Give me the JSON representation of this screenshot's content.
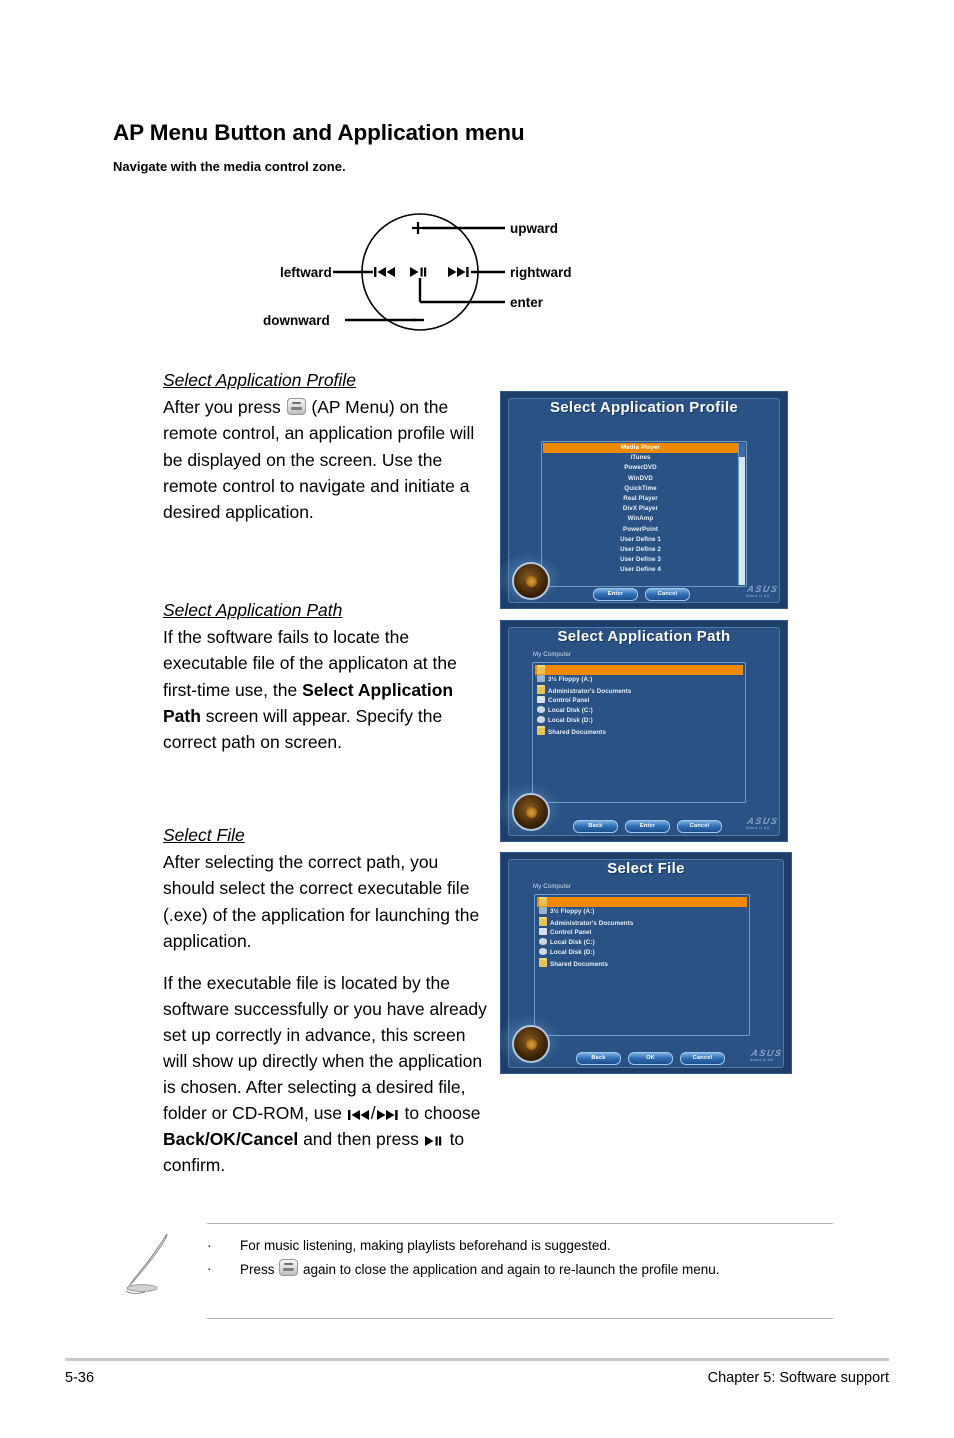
{
  "heading": {
    "title": "AP Menu Button and Application menu",
    "subtitle": "Navigate with the media control zone."
  },
  "diagram": {
    "name": "media-control-zone",
    "labels": {
      "upward": "upward",
      "rightward": "rightward",
      "enter": "enter",
      "downward": "downward",
      "leftward": "leftward"
    },
    "symbols": {
      "plus": "+",
      "minus": "−",
      "prev": "prev-track-icon",
      "play_pause": "play-pause-icon",
      "next": "next-track-icon"
    }
  },
  "sections": [
    {
      "id": "select-application-profile",
      "title": "Select Application Profile",
      "paragraphs": [
        {
          "parts": [
            {
              "text": "After you press "
            },
            {
              "icon": "ap-menu-key-icon"
            },
            {
              "text": " (AP Menu) on the remote control, an application profile will be displayed on the screen. Use the remote control to navigate and initiate a desired application."
            }
          ]
        }
      ]
    },
    {
      "id": "select-application-path",
      "title": "Select Application Path",
      "paragraphs": [
        {
          "parts": [
            {
              "text": "If the software fails to locate the executable file of the applicaton at the first-time use, the "
            },
            {
              "text": "Select Application Path",
              "bold": true
            },
            {
              "text": " screen will appear. Specify the correct path on screen."
            }
          ]
        }
      ]
    },
    {
      "id": "select-file",
      "title": "Select File",
      "paragraphs": [
        {
          "parts": [
            {
              "text": "After selecting the correct path, you should select the correct executable file (.exe) of the application for launching the application."
            }
          ]
        },
        {
          "parts": [
            {
              "text": "If the executable file is located by the software successfully or you have already set up correctly in advance, this screen will show up directly when the application is chosen. After selecting a desired file, folder or CD-ROM, use "
            },
            {
              "icon": "prev-track-icon"
            },
            {
              "text": "/"
            },
            {
              "icon": "next-track-icon"
            },
            {
              "text": " to choose "
            },
            {
              "text": "Back/OK/Cancel",
              "bold": true
            },
            {
              "text": " and then press "
            },
            {
              "icon": "play-pause-icon"
            },
            {
              "text": " to confirm."
            }
          ]
        }
      ]
    }
  ],
  "screenshots": [
    {
      "id": "select-application-profile-screen",
      "title": "Select Application Profile",
      "subtitle": "",
      "selected_index": 0,
      "items": [
        "Media Player",
        "iTunes",
        "PowerDVD",
        "WinDVD",
        "QuickTime",
        "Real Player",
        "DivX Player",
        "WinAmp",
        "PowerPoint",
        "User Define 1",
        "User Define 2",
        "User Define 3",
        "User Define 4"
      ],
      "buttons": [
        "Enter",
        "Cancel"
      ],
      "scrollbar": true,
      "brand": "ASUS",
      "brand_sub": "Smart in All"
    },
    {
      "id": "select-application-path-screen",
      "title": "Select Application Path",
      "subtitle": "My Computer",
      "selected_index": 0,
      "items": [
        {
          "label": "",
          "icon": "folder-icon"
        },
        {
          "label": "3½ Floppy (A:)",
          "icon": "floppy-icon"
        },
        {
          "label": "Administrator's Documents",
          "icon": "folder-icon"
        },
        {
          "label": "Control Panel",
          "icon": "control-panel-icon"
        },
        {
          "label": "Local Disk (C:)",
          "icon": "disk-icon"
        },
        {
          "label": "Local Disk (D:)",
          "icon": "disk-icon"
        },
        {
          "label": "Shared Documents",
          "icon": "folder-icon"
        }
      ],
      "buttons": [
        "Back",
        "Enter",
        "Cancel"
      ],
      "scrollbar": false,
      "brand": "ASUS",
      "brand_sub": "Smart in All"
    },
    {
      "id": "select-file-screen",
      "title": "Select File",
      "subtitle": "My Computer",
      "selected_index": 0,
      "items": [
        {
          "label": "",
          "icon": "folder-icon"
        },
        {
          "label": "3½ Floppy (A:)",
          "icon": "floppy-icon"
        },
        {
          "label": "Administrator's Documents",
          "icon": "folder-icon"
        },
        {
          "label": "Control Panel",
          "icon": "control-panel-icon"
        },
        {
          "label": "Local Disk (C:)",
          "icon": "disk-icon"
        },
        {
          "label": "Local Disk (D:)",
          "icon": "disk-icon"
        },
        {
          "label": "Shared Documents",
          "icon": "folder-icon"
        }
      ],
      "buttons": [
        "Back",
        "OK",
        "Cancel"
      ],
      "scrollbar": false,
      "brand": "ASUS",
      "brand_sub": "Smart in All"
    }
  ],
  "note": {
    "icon": "pen-note-icon",
    "bullet": "·",
    "items": [
      {
        "parts": [
          {
            "text": "For music listening, making playlists beforehand is suggested."
          }
        ]
      },
      {
        "parts": [
          {
            "text": "Press "
          },
          {
            "icon": "ap-menu-key-icon"
          },
          {
            "text": " again to close the application and again to re-launch the profile menu."
          }
        ]
      }
    ]
  },
  "footer": {
    "page_number": "5-36",
    "chapter": "Chapter 5: Software support"
  },
  "colors": {
    "screen_blue": "#2a5284",
    "screen_border": "#1d3f68",
    "highlight_orange": "#f08a06",
    "rule_gray": "#c9c9c9"
  }
}
